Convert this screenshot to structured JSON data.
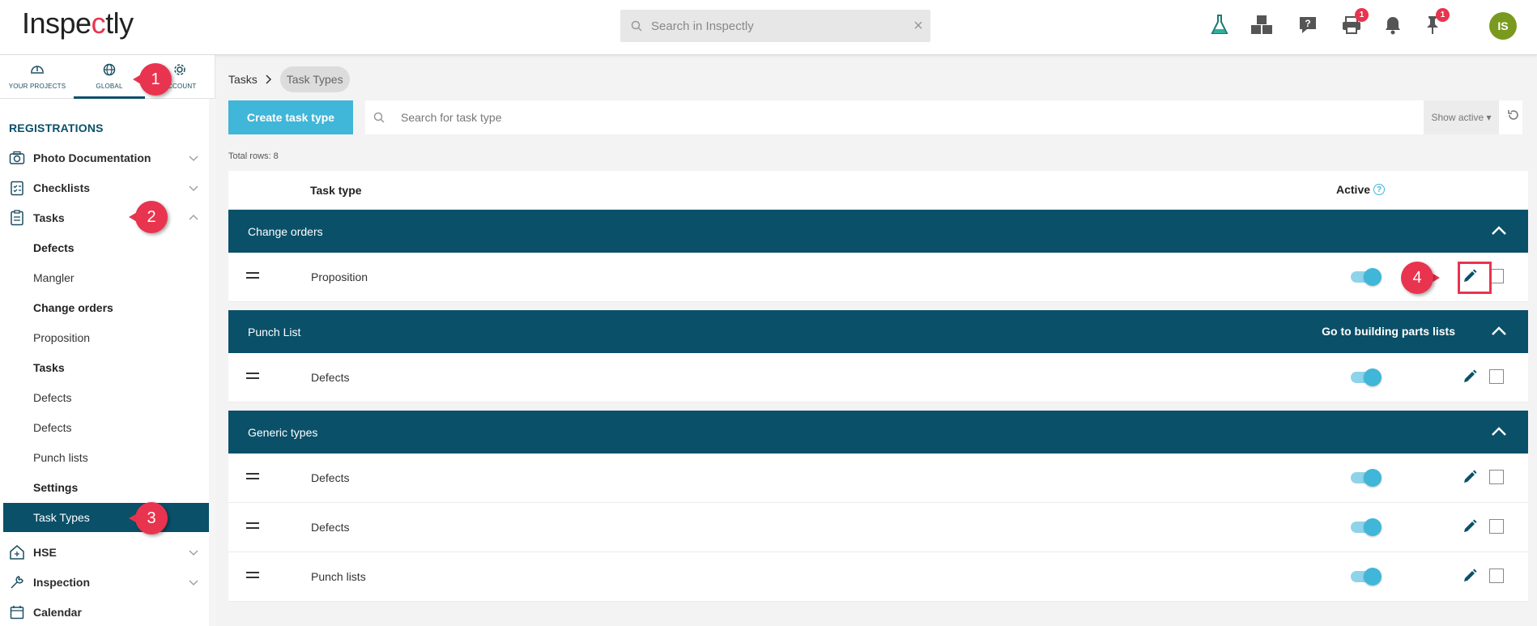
{
  "app": {
    "logo": "Inspectly"
  },
  "top_search": {
    "placeholder": "Search in Inspectly",
    "clear": "×"
  },
  "top_icons": [
    {
      "name": "flask-icon"
    },
    {
      "name": "cubes-icon"
    },
    {
      "name": "help-icon"
    },
    {
      "name": "print-icon",
      "badge": "1"
    },
    {
      "name": "bell-icon"
    },
    {
      "name": "pin-icon",
      "badge": "1"
    }
  ],
  "user": {
    "initials": "IS"
  },
  "sidebar": {
    "tabs": [
      {
        "label": "YOUR PROJECTS"
      },
      {
        "label": "GLOBAL"
      },
      {
        "label": "ACCOUNT"
      }
    ],
    "heading": "REGISTRATIONS",
    "items": [
      {
        "label": "Photo Documentation"
      },
      {
        "label": "Checklists"
      },
      {
        "label": "Tasks"
      },
      {
        "label": "Defects"
      },
      {
        "label": "Mangler"
      },
      {
        "label": "Change orders"
      },
      {
        "label": "Proposition"
      },
      {
        "label": "Tasks"
      },
      {
        "label": "Defects"
      },
      {
        "label": "Defects"
      },
      {
        "label": "Punch lists"
      },
      {
        "label": "Settings"
      },
      {
        "label": "Task Types"
      },
      {
        "label": "HSE"
      },
      {
        "label": "Inspection"
      },
      {
        "label": "Calendar"
      }
    ]
  },
  "breadcrumb": {
    "root": "Tasks",
    "current": "Task Types"
  },
  "toolbar": {
    "create_label": "Create task type",
    "search_placeholder": "Search for task type",
    "show_active": "Show active ▾"
  },
  "total_rows": "Total rows: 8",
  "table": {
    "col_type": "Task type",
    "col_active": "Active",
    "groups": [
      {
        "label": "Change orders",
        "link": "",
        "rows": [
          "Proposition"
        ]
      },
      {
        "label": "Punch List",
        "link": "Go to building parts lists",
        "rows": [
          "Defects"
        ]
      },
      {
        "label": "Generic types",
        "link": "",
        "rows": [
          "Defects",
          "Defects",
          "Punch lists"
        ]
      }
    ]
  },
  "annotations": [
    "1",
    "2",
    "3",
    "4"
  ],
  "colors": {
    "primary": "#0a5069",
    "accent": "#40b6d8",
    "callout": "#e8344e"
  }
}
